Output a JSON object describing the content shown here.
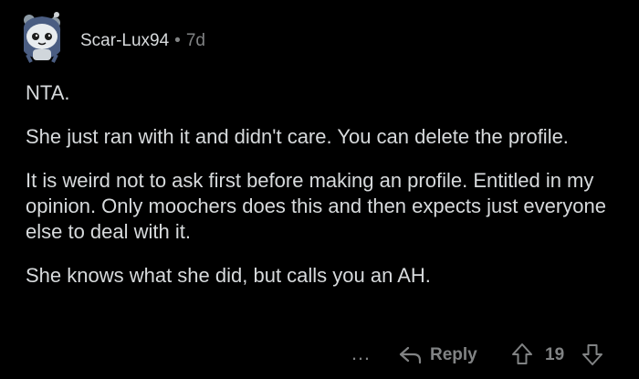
{
  "comment": {
    "username": "Scar-Lux94",
    "separator": "•",
    "age": "7d",
    "paragraphs": [
      "NTA.",
      "She just ran with it and didn't care. You can delete the profile.",
      "It is weird not to ask first before making an profile. Entitled in my opinion. Only moochers does this and then expects just everyone else to deal with it.",
      "She knows what she did, but calls you an AH."
    ]
  },
  "actions": {
    "more_label": "…",
    "reply_label": "Reply",
    "vote_count": "19"
  },
  "icons": {
    "avatar": "snoo-avatar-icon",
    "reply": "reply-arrow-icon",
    "upvote": "upvote-arrow-icon",
    "downvote": "downvote-arrow-icon"
  },
  "colors": {
    "background": "#000000",
    "text": "#d7dadc",
    "muted": "#818384"
  }
}
